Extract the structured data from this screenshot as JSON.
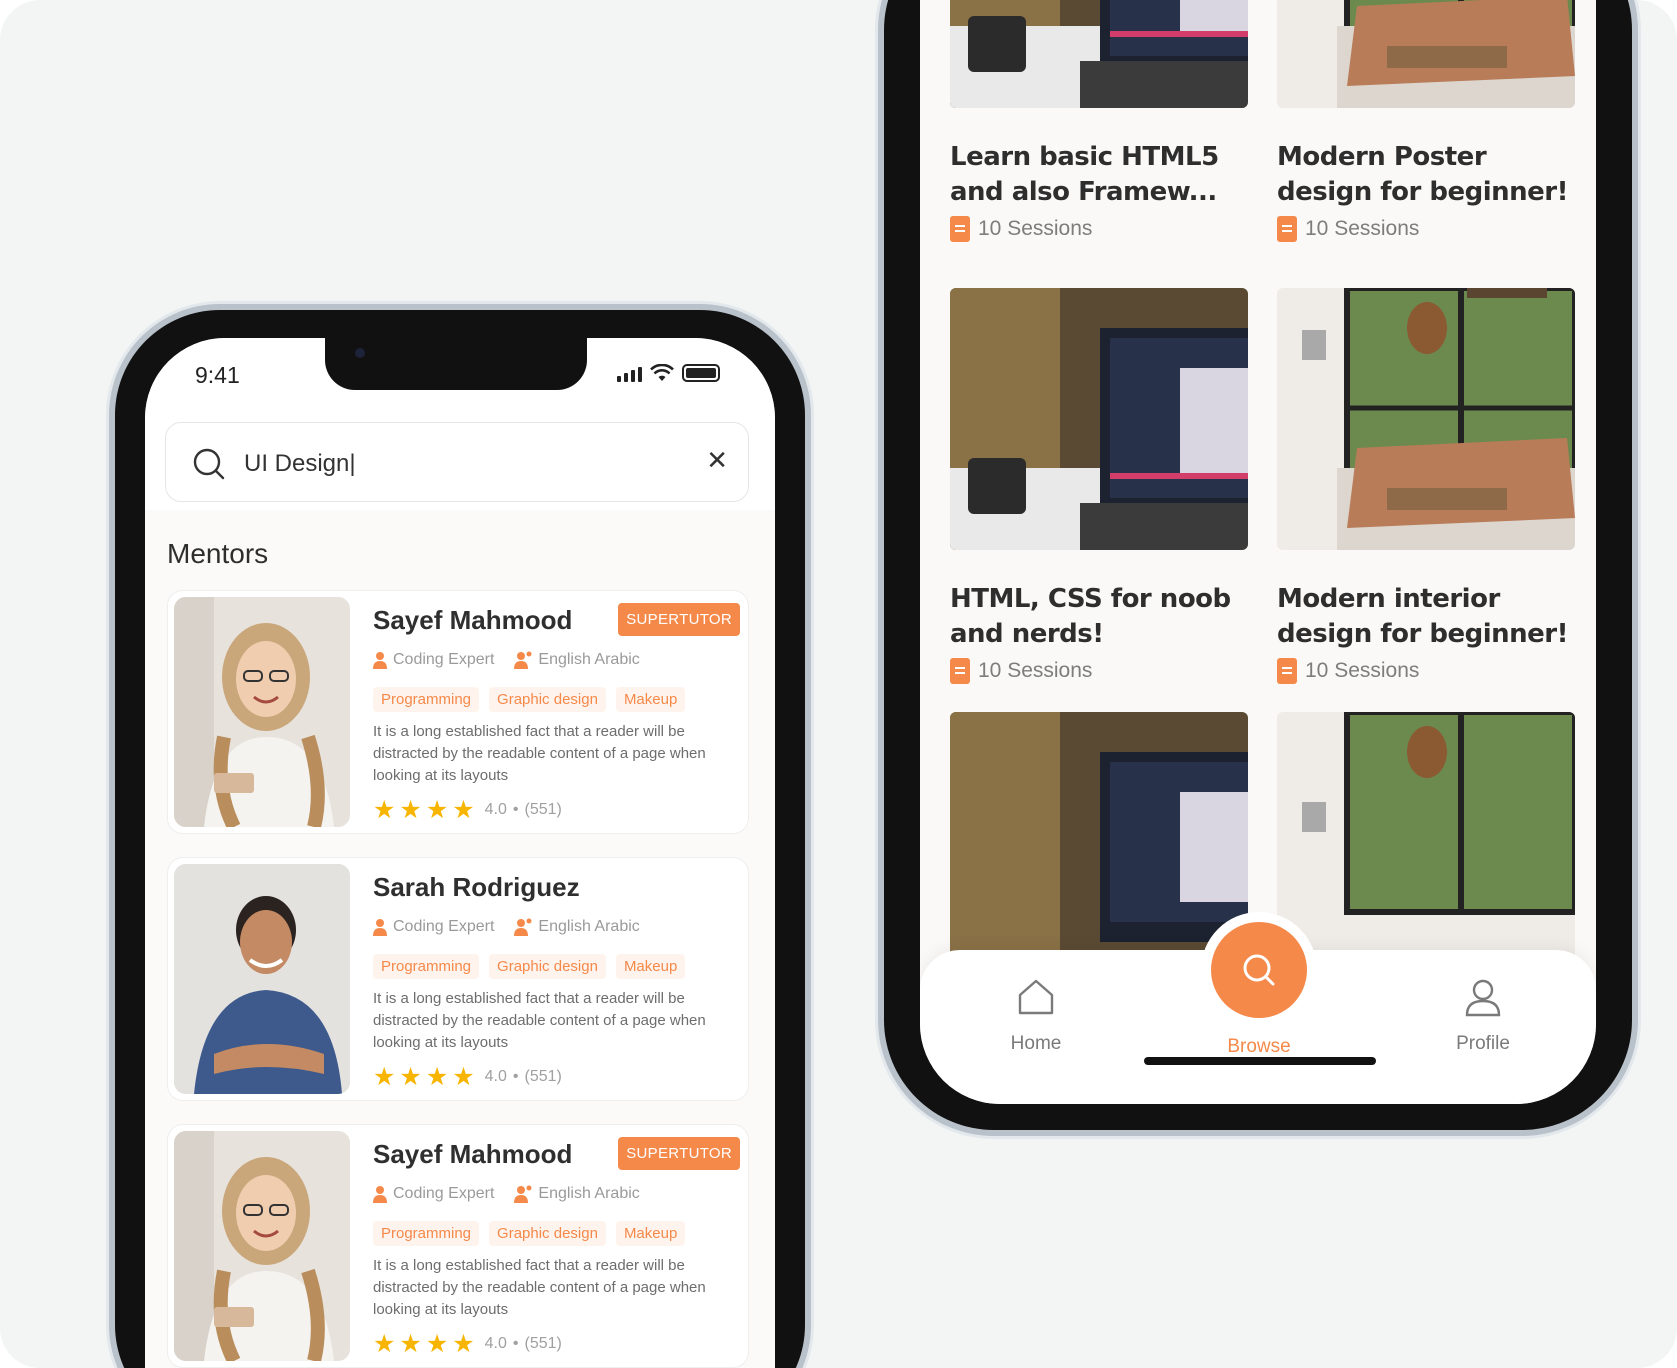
{
  "phone_search": {
    "status": {
      "time": "9:41"
    },
    "search": {
      "value": "UI Design|",
      "clear_icon": "close-icon",
      "icon": "search-icon"
    },
    "section_title": "Mentors",
    "mentors": [
      {
        "name": "Sayef Mahmood",
        "badge": "SUPERTUTOR",
        "role": "Coding Expert",
        "languages": "English Arabic",
        "tags": [
          "Programming",
          "Graphic design",
          "Makeup"
        ],
        "description": "It is a long established fact that a reader will be distracted by the readable content of a page when looking at its layouts",
        "rating": "4.0",
        "reviews": "(551)"
      },
      {
        "name": "Sarah Rodriguez",
        "badge": "",
        "role": "Coding Expert",
        "languages": "English Arabic",
        "tags": [
          "Programming",
          "Graphic design",
          "Makeup"
        ],
        "description": "It is a long established fact that a reader will be distracted by the readable content of a page when looking at its layouts",
        "rating": "4.0",
        "reviews": "(551)"
      },
      {
        "name": "Sayef Mahmood",
        "badge": "SUPERTUTOR",
        "role": "Coding Expert",
        "languages": "English Arabic",
        "tags": [
          "Programming",
          "Graphic design",
          "Makeup"
        ],
        "description": "It is a long established fact that a reader will be distracted by the readable content of a page when looking at its layouts",
        "rating": "4.0",
        "reviews": "(551)"
      }
    ]
  },
  "phone_browse": {
    "courses": [
      {
        "title": "Learn basic HTML5 and also Framew...",
        "sessions": "10 Sessions",
        "thumb": "laptop"
      },
      {
        "title": "Modern Poster design for beginner!",
        "sessions": "10 Sessions",
        "thumb": "interior"
      },
      {
        "title": "HTML, CSS for noob and nerds!",
        "sessions": "10 Sessions",
        "thumb": "laptop"
      },
      {
        "title": "Modern interior design for beginner!",
        "sessions": "10 Sessions",
        "thumb": "interior"
      },
      {
        "title": "",
        "sessions": "",
        "thumb": "laptop"
      },
      {
        "title": "",
        "sessions": "",
        "thumb": "interior"
      }
    ],
    "tabbar": {
      "home": {
        "label": "Home",
        "icon": "home-icon"
      },
      "browse": {
        "label": "Browse",
        "icon": "search-icon"
      },
      "profile": {
        "label": "Profile",
        "icon": "user-icon"
      }
    }
  },
  "colors": {
    "accent": "#f5894a",
    "star": "#f7b500",
    "background": "#f2f5f4"
  }
}
